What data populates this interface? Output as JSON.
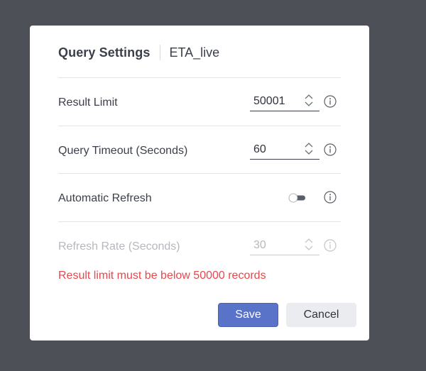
{
  "dialog": {
    "title": "Query Settings",
    "subtitle": "ETA_live"
  },
  "settings": {
    "result_limit": {
      "label": "Result Limit",
      "value": "50001"
    },
    "query_timeout": {
      "label": "Query Timeout (Seconds)",
      "value": "60"
    },
    "automatic_refresh": {
      "label": "Automatic Refresh",
      "enabled": false
    },
    "refresh_rate": {
      "label": "Refresh Rate (Seconds)",
      "value": "30",
      "disabled": true
    }
  },
  "error_message": "Result limit must be below 50000 records",
  "buttons": {
    "save_label": "Save",
    "cancel_label": "Cancel"
  },
  "colors": {
    "overlay": "#4d5057",
    "primary": "#5873c7",
    "error": "#e5484d",
    "text": "#3b3f4a",
    "disabled_text": "#b6b8be"
  },
  "icons": {
    "info": "info-icon",
    "stepper": "up-down-chevron-icon",
    "toggle": "toggle-switch"
  }
}
